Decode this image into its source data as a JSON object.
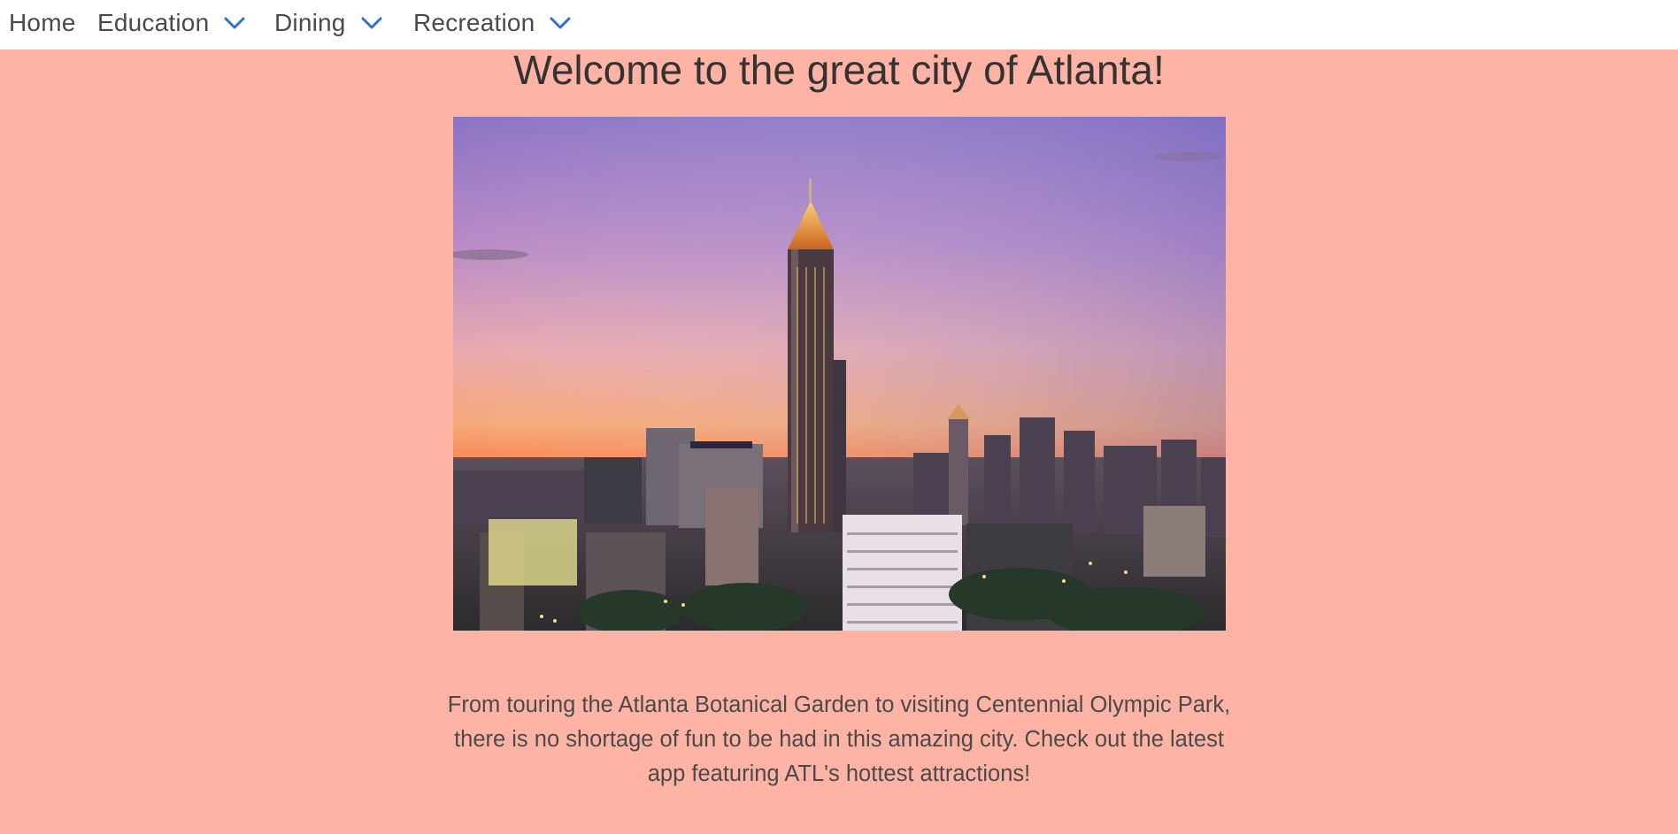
{
  "nav": {
    "items": [
      {
        "label": "Home",
        "has_dropdown": false
      },
      {
        "label": "Education",
        "has_dropdown": true
      },
      {
        "label": "Dining",
        "has_dropdown": true
      },
      {
        "label": "Recreation",
        "has_dropdown": true
      }
    ],
    "dropdown_icon": "chevron-down-icon",
    "accent_color": "#2f6fd6"
  },
  "main": {
    "title": "Welcome to the great city of Atlanta!",
    "hero_image_icon": "atlanta-skyline-photo",
    "description": "From touring the Atlanta Botanical Garden to visiting Centennial Olympic Park, there is no shortage of fun to be had in this amazing city. Check out the latest app featuring ATL's hottest attractions!"
  },
  "colors": {
    "page_background": "#ffb3a5",
    "navbar_background": "#ffffff",
    "text": "#3b3b3b"
  }
}
